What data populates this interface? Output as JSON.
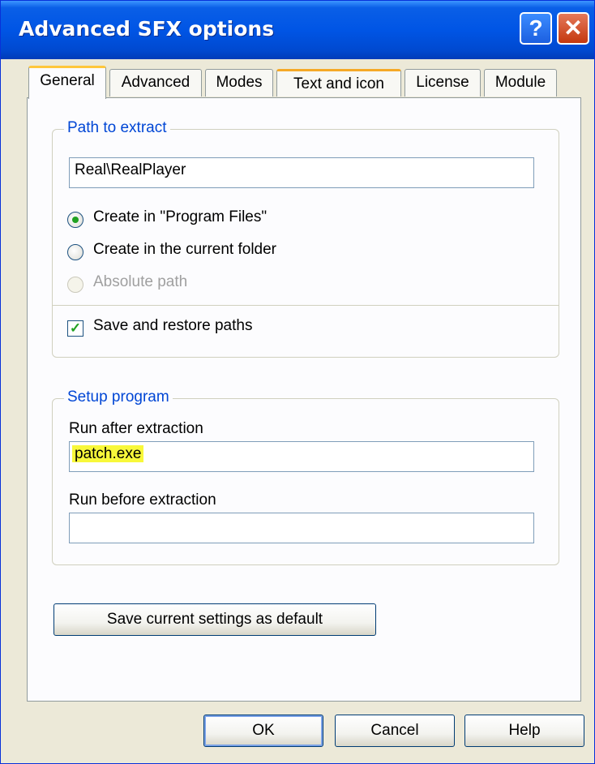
{
  "window": {
    "title": "Advanced SFX options"
  },
  "titlebar_buttons": {
    "help": "?",
    "close": "✕"
  },
  "tabs": [
    {
      "label": "General"
    },
    {
      "label": "Advanced"
    },
    {
      "label": "Modes"
    },
    {
      "label": "Text and icon"
    },
    {
      "label": "License"
    },
    {
      "label": "Module"
    }
  ],
  "path_group": {
    "legend": "Path to extract",
    "path_value": "Real\\RealPlayer",
    "radio_program_files": "Create in \"Program Files\"",
    "radio_current_folder": "Create in the current folder",
    "radio_absolute": "Absolute path",
    "save_restore": "Save and restore paths"
  },
  "setup_group": {
    "legend": "Setup program",
    "run_after_label": "Run after extraction",
    "run_after_value": "patch.exe",
    "run_before_label": "Run before extraction",
    "run_before_value": ""
  },
  "save_default_button": "Save current settings as default",
  "dialog_buttons": {
    "ok": "OK",
    "cancel": "Cancel",
    "help": "Help"
  },
  "colors": {
    "title_bar": "#0055e5",
    "dialog_bg": "#ece9d8",
    "group_legend": "#0046d5",
    "highlight": "#f8f83a"
  }
}
